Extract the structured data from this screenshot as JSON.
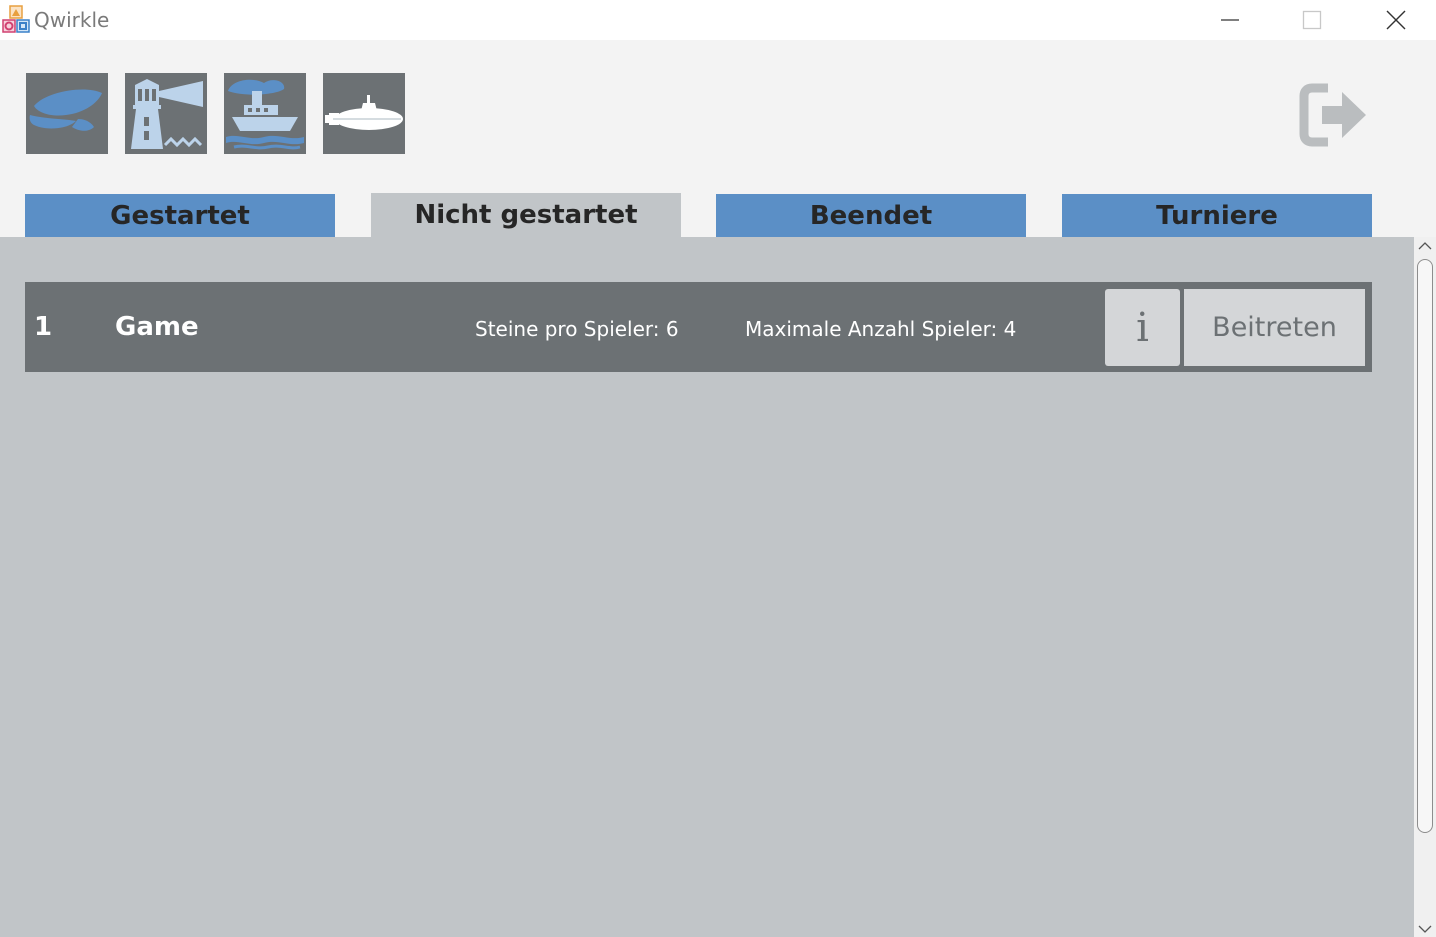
{
  "window": {
    "title": "Qwirkle"
  },
  "toolbar": {
    "icons": [
      "captain-hat-icon",
      "lighthouse-icon",
      "ship-icon",
      "submarine-icon"
    ],
    "logout_icon": "logout-icon"
  },
  "tabs": [
    {
      "label": "Gestartet",
      "active": false
    },
    {
      "label": "Nicht gestartet",
      "active": true
    },
    {
      "label": "Beendet",
      "active": false
    },
    {
      "label": "Turniere",
      "active": false
    }
  ],
  "games": [
    {
      "index": "1",
      "name": "Game",
      "stones": "Steine pro Spieler: 6",
      "max_players": "Maximale Anzahl Spieler: 4",
      "info_label": "i",
      "join_label": "Beitreten"
    }
  ],
  "colors": {
    "tab_inactive": "#5b8fc6",
    "tab_active": "#c1c5c8",
    "content_bg": "#c1c5c8",
    "row_bg": "#6c7174",
    "icon_blue": "#5b8fc6",
    "icon_light": "#bcd3ea"
  }
}
